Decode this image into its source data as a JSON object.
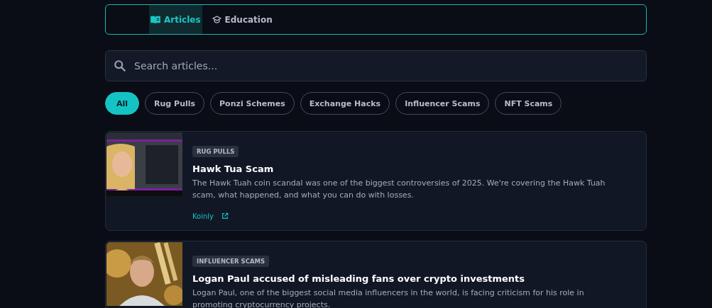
{
  "tabs": [
    {
      "label": "Articles",
      "selected": true
    },
    {
      "label": "Education",
      "selected": false
    }
  ],
  "search": {
    "placeholder": "Search articles..."
  },
  "filters": [
    {
      "label": "All",
      "selected": true
    },
    {
      "label": "Rug Pulls",
      "selected": false
    },
    {
      "label": "Ponzi Schemes",
      "selected": false
    },
    {
      "label": "Exchange Hacks",
      "selected": false
    },
    {
      "label": "Influencer Scams",
      "selected": false
    },
    {
      "label": "NFT Scams",
      "selected": false
    }
  ],
  "articles": [
    {
      "tag": "RUG PULLS",
      "title": "Hawk Tua Scam",
      "summary": "The Hawk Tuah coin scandal was one of the biggest controversies of 2025. We're covering the Hawk Tuah scam, what happened, and what you can do with losses.",
      "source": "Koinly"
    },
    {
      "tag": "INFLUENCER SCAMS",
      "title": "Logan Paul accused of misleading fans over crypto investments",
      "summary": "Logan Paul, one of the biggest social media influencers in the world, is facing criticism for his role in promoting cryptocurrency projects."
    }
  ]
}
